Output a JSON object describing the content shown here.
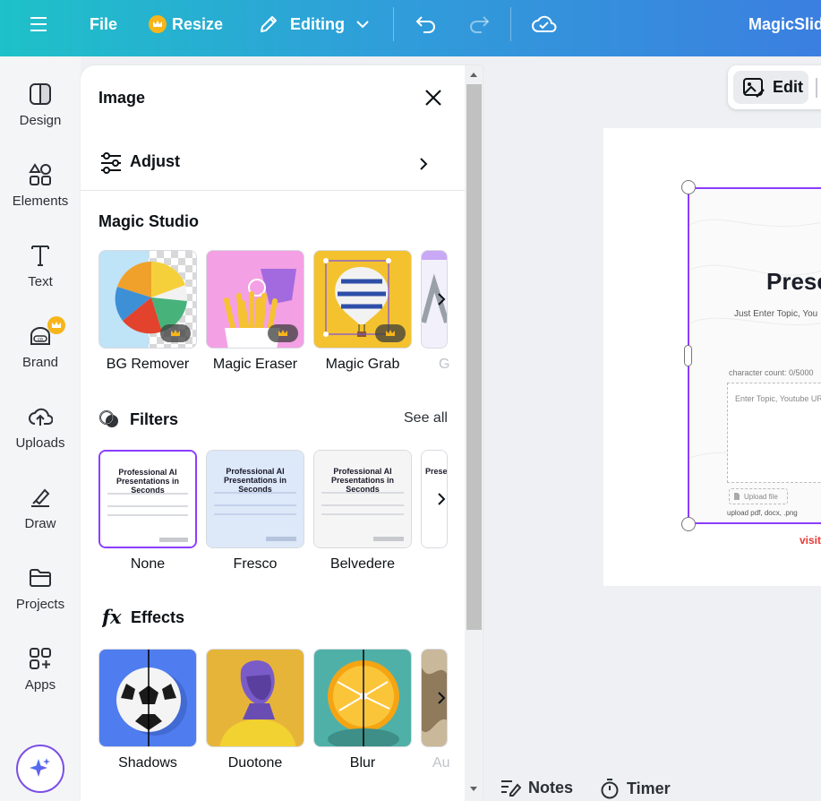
{
  "topbar": {
    "file_label": "File",
    "resize_label": "Resize",
    "editing_label": "Editing",
    "app_title": "MagicSlid"
  },
  "rail": {
    "items": [
      {
        "label": "Design",
        "icon": "design-icon"
      },
      {
        "label": "Elements",
        "icon": "elements-icon"
      },
      {
        "label": "Text",
        "icon": "text-icon"
      },
      {
        "label": "Brand",
        "icon": "brand-icon"
      },
      {
        "label": "Uploads",
        "icon": "uploads-icon"
      },
      {
        "label": "Draw",
        "icon": "draw-icon"
      },
      {
        "label": "Projects",
        "icon": "projects-icon"
      },
      {
        "label": "Apps",
        "icon": "apps-icon"
      }
    ]
  },
  "panel": {
    "title": "Image",
    "adjust_label": "Adjust",
    "magic_studio": {
      "title": "Magic Studio",
      "tools": [
        {
          "label": "BG Remover"
        },
        {
          "label": "Magic Eraser"
        },
        {
          "label": "Magic Grab"
        },
        {
          "label": "G"
        }
      ]
    },
    "filters": {
      "title": "Filters",
      "see_all": "See all",
      "thumb_heading_1": "Professional AI",
      "thumb_heading_2": "Presentations in Seconds",
      "thumb_heading_partial": "Prese",
      "items": [
        {
          "label": "None"
        },
        {
          "label": "Fresco"
        },
        {
          "label": "Belvedere"
        }
      ]
    },
    "effects": {
      "title": "Effects",
      "items": [
        {
          "label": "Shadows"
        },
        {
          "label": "Duotone"
        },
        {
          "label": "Blur"
        },
        {
          "label": "Au"
        }
      ]
    }
  },
  "canvas": {
    "edit_label": "Edit",
    "slide_title": "Prese",
    "slide_subtitle": "Just Enter Topic, You",
    "char_count": "character count: 0/5000",
    "input_placeholder": "Enter Topic, Youtube UR",
    "upload_label": "Upload file",
    "upload_hint": "upload pdf, docx, .png",
    "visit_text": "visit"
  },
  "bottom": {
    "notes_label": "Notes",
    "timer_label": "Timer"
  },
  "colors": {
    "accent": "#8b3dff",
    "crown": "#f7b51a",
    "topbar_start": "#1ec1c8",
    "topbar_end": "#3b7fe0"
  }
}
